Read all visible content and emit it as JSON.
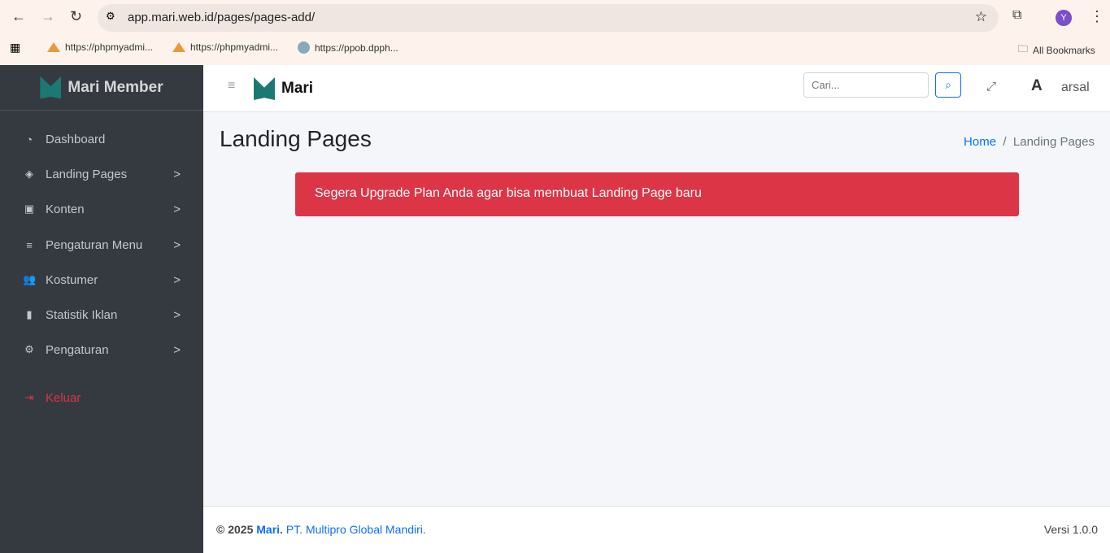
{
  "browser": {
    "url": "app.mari.web.id/pages/pages-add/",
    "bookmarks": [
      "https://phpmyadmi...",
      "https://phpmyadmi...",
      "https://ppob.dpph..."
    ],
    "all_bookmarks": "All Bookmarks",
    "profile_initial": "Y"
  },
  "sidebar": {
    "brand": "Mari Member",
    "items": [
      {
        "label": "Dashboard",
        "icon": "gauge-icon"
      },
      {
        "label": "Landing Pages",
        "icon": "layers-icon"
      },
      {
        "label": "Konten",
        "icon": "image-icon"
      },
      {
        "label": "Pengaturan Menu",
        "icon": "bars-icon"
      },
      {
        "label": "Kostumer",
        "icon": "users-icon"
      },
      {
        "label": "Statistik Iklan",
        "icon": "chart-icon"
      },
      {
        "label": "Pengaturan",
        "icon": "gear-icon"
      }
    ],
    "logout": "Keluar"
  },
  "topbar": {
    "brand": "Mari",
    "search_placeholder": "Cari...",
    "user": "arsal"
  },
  "page": {
    "title": "Landing Pages",
    "breadcrumb": [
      "Home",
      "Landing Pages"
    ],
    "alert": "Segera Upgrade Plan Anda agar bisa membuat Landing Page baru"
  },
  "footer": {
    "copyright": "© 2025",
    "brand": "Mari.",
    "company": "PT. Multipro Global Mandiri.",
    "version": "Versi 1.0.0"
  }
}
